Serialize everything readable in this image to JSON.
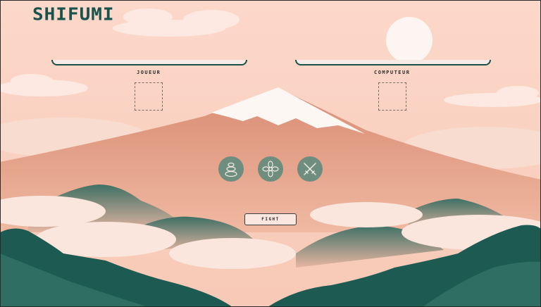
{
  "app": {
    "title": "SHIFUMI"
  },
  "players": {
    "player_label": "JOUEUR",
    "computer_label": "COMPUTEUR"
  },
  "choices": [
    {
      "id": "rock",
      "icon": "stacked-stones-icon"
    },
    {
      "id": "paper",
      "icon": "flower-icon"
    },
    {
      "id": "scissors",
      "icon": "crossed-swords-icon"
    }
  ],
  "actions": {
    "fight_label": "FIGHT"
  },
  "colors": {
    "sky": "#fbd9cc",
    "mountain": "#e3a189",
    "forest": "#1c5a52",
    "accent": "#17524c",
    "button_circle": "#6f8e7f"
  }
}
